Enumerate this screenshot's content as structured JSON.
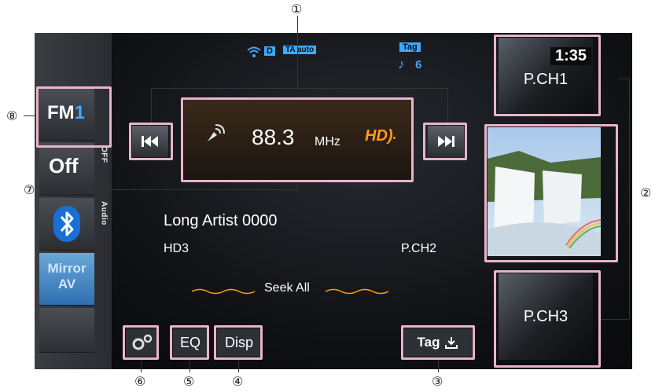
{
  "status": {
    "signal_d": "D",
    "ta_label": "TA auto",
    "tag_label": "Tag",
    "tag_count": "6",
    "clock": "1:35"
  },
  "source": {
    "fm_prefix": "FM",
    "fm_band": "1",
    "off_label": "Off",
    "off_tab": "OFF",
    "audio_tab": "Audio",
    "mirror_line1": "Mirror",
    "mirror_line2": "AV"
  },
  "tuner": {
    "frequency": "88.3",
    "unit": "MHz",
    "hd_label": "HD"
  },
  "info": {
    "artist": "Long Artist 0000",
    "channel": "HD3",
    "preset_channel": "P.CH2",
    "seek_mode": "Seek All"
  },
  "presets": {
    "p1": "P.CH1",
    "p3": "P.CH3"
  },
  "toolbar": {
    "eq_label": "EQ",
    "disp_label": "Disp",
    "tag_label": "Tag"
  },
  "callouts": {
    "c1": "①",
    "c2": "②",
    "c3": "③",
    "c4": "④",
    "c5": "⑤",
    "c6": "⑥",
    "c7": "⑦",
    "c8": "⑧"
  },
  "colors": {
    "highlight": "#e8b4c9",
    "accent_blue": "#3fa8ff",
    "accent_orange": "#ff9c1a"
  }
}
